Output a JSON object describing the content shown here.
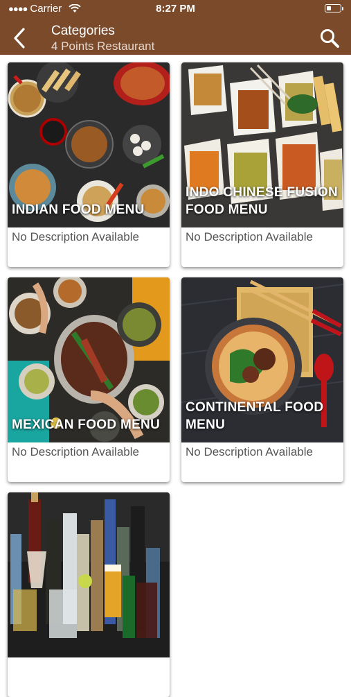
{
  "status_bar": {
    "carrier": "Carrier",
    "time": "8:27 PM"
  },
  "header": {
    "title": "Categories",
    "subtitle": "4 Points Restaurant",
    "back_icon": "chevron-left-icon",
    "search_icon": "search-icon"
  },
  "colors": {
    "header_bg": "#7a4a2a",
    "card_bg": "#ffffff",
    "desc_text": "#555555"
  },
  "categories": [
    {
      "name": "INDIAN FOOD MENU",
      "description": "No Description Available"
    },
    {
      "name": "INDO CHINESE FUSION FOOD MENU",
      "description": "No Description Available"
    },
    {
      "name": "MEXICAN FOOD MENU",
      "description": "No Description Available"
    },
    {
      "name": "CONTINENTAL FOOD MENU",
      "description": "No Description Available"
    },
    {
      "name": "",
      "description": ""
    }
  ]
}
